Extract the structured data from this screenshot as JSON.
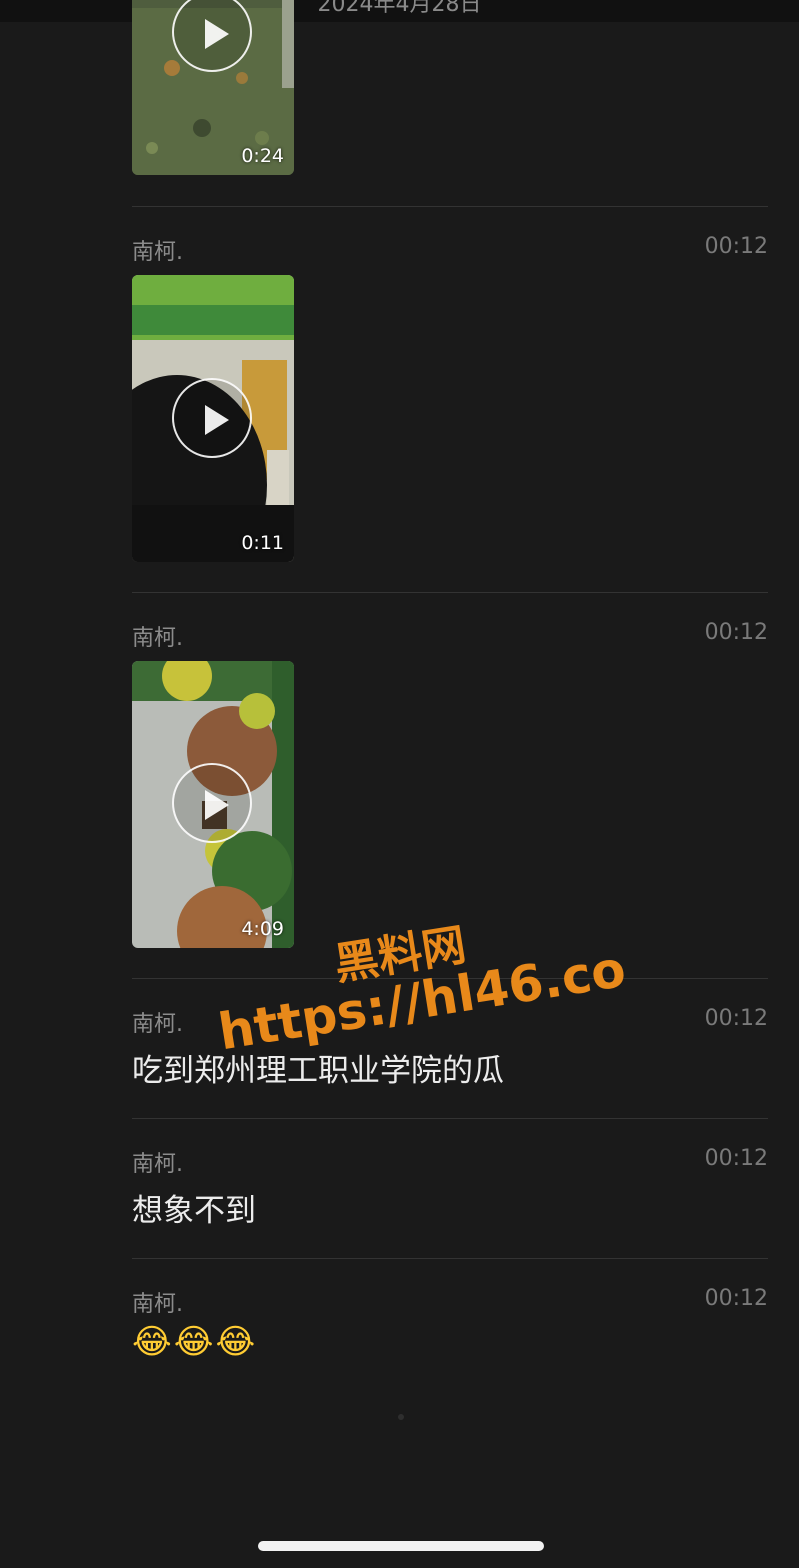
{
  "header": {
    "date": "2024年4月28日"
  },
  "messages": [
    {
      "type": "video",
      "sender": "",
      "time": "",
      "duration": "0:24"
    },
    {
      "type": "video",
      "sender": "南柯.",
      "time": "00:12",
      "duration": "0:11"
    },
    {
      "type": "video",
      "sender": "南柯.",
      "time": "00:12",
      "duration": "4:09"
    },
    {
      "type": "text",
      "sender": "南柯.",
      "time": "00:12",
      "text": "吃到郑州理工职业学院的瓜"
    },
    {
      "type": "text",
      "sender": "南柯.",
      "time": "00:12",
      "text": "想象不到"
    },
    {
      "type": "emoji",
      "sender": "南柯.",
      "time": "00:12",
      "text": "😂😂😂"
    }
  ],
  "watermark": {
    "line1": "黑料网",
    "line2": "https://hl46.co"
  },
  "colors": {
    "background": "#1a1a1a",
    "watermark": "#e8891a"
  }
}
